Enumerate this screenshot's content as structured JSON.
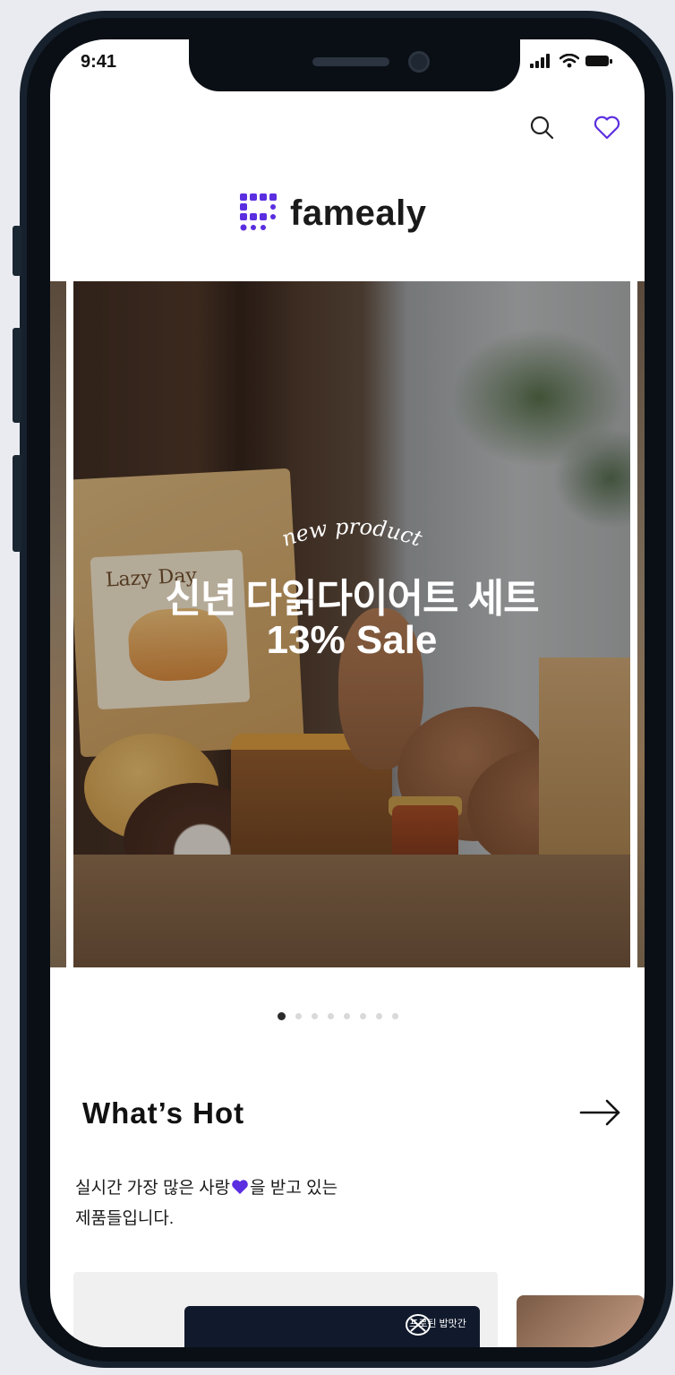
{
  "status_bar": {
    "time": "9:41"
  },
  "header": {
    "icons": [
      "search-icon",
      "heart-icon"
    ],
    "brand_name": "famealy"
  },
  "banner": {
    "kicker": "new product",
    "title": "신년 다읽다이어트 세트",
    "subtitle": "13% Sale",
    "package_label": "Lazy Day",
    "slide_count": 8,
    "active_slide": 1
  },
  "whats_hot": {
    "title": "What’s Hot",
    "description_before": "실시간 가장 많은 사랑",
    "description_after": "을 받고 있는",
    "description_line2": "제품들입니다.",
    "cards": [
      {
        "brand_text": "프로틴 밥맛간"
      }
    ]
  },
  "colors": {
    "accent": "#5b2ee0",
    "text": "#111111",
    "frame": "#16212d"
  }
}
